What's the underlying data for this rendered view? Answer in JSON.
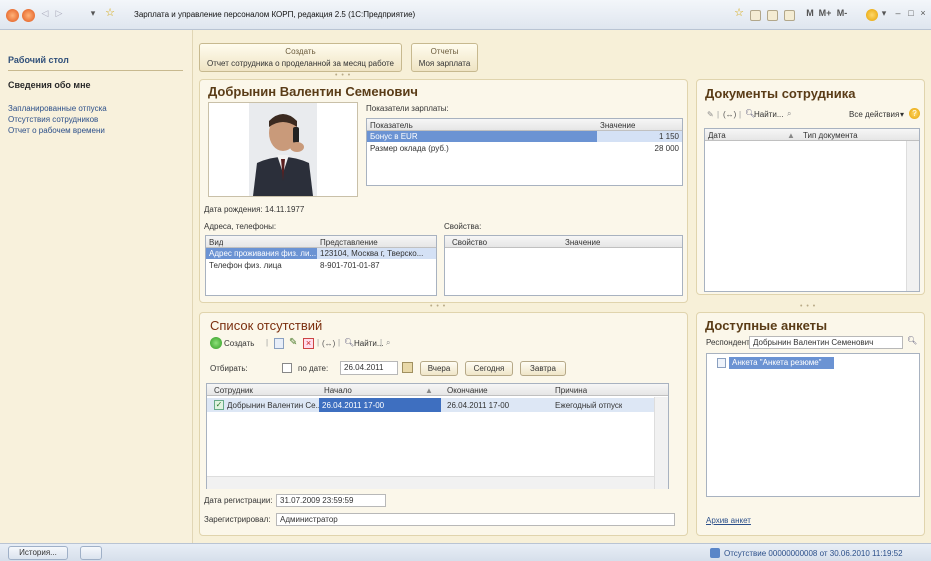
{
  "window": {
    "title": "Зарплата и управление персоналом КОРП, редакция 2.5  (1С:Предприятие)",
    "right_controls": [
      "M",
      "M+",
      "M-",
      "–",
      "□",
      "×"
    ]
  },
  "sidebar": {
    "desktop": "Рабочий стол",
    "section": "Сведения обо мне",
    "items": [
      "Запланированные отпуска",
      "Отсутствия сотрудников",
      "Отчет о рабочем времени"
    ]
  },
  "commands": {
    "create_label": "Создать",
    "create_item": "Отчет сотрудника о проделанной за месяц работе",
    "reports_label": "Отчеты",
    "reports_item": "Моя зарплата"
  },
  "employee": {
    "name": "Добрынин Валентин Семенович",
    "salary_caption": "Показатели зарплаты:",
    "salary_headers": [
      "Показатель",
      "Значение"
    ],
    "salary_rows": [
      {
        "name": "Бонус в EUR",
        "value": "1 150"
      },
      {
        "name": "Размер оклада (руб.)",
        "value": "28 000"
      }
    ],
    "birth": "Дата рождения:  14.11.1977",
    "addresses_caption": "Адреса, телефоны:",
    "addr_headers": [
      "Вид",
      "Представление"
    ],
    "addr_rows": [
      {
        "kind": "Адрес проживания физ. ли...",
        "value": "123104, Москва г, Тверско..."
      },
      {
        "kind": "Телефон физ. лица",
        "value": "8-901-701-01-87"
      }
    ],
    "props_caption": "Свойства:",
    "props_headers": [
      "Свойство",
      "Значение"
    ]
  },
  "absences": {
    "title": "Список отсутствий",
    "toolbar": {
      "create": "Создать",
      "find": "Найти..."
    },
    "filter_label": "Отбирать:",
    "by_date": "по дате:",
    "date": "26.04.2011",
    "btn_yesterday": "Вчера",
    "btn_today": "Сегодня",
    "btn_tomorrow": "Завтра",
    "headers": [
      "Сотрудник",
      "Начало",
      "Окончание",
      "Причина"
    ],
    "rows": [
      {
        "employee": "Добрынин Валентин Се...",
        "start": "26.04.2011 17-00",
        "end": "26.04.2011 17-00",
        "reason": "Ежегодный отпуск"
      }
    ],
    "reg_date_label": "Дата регистрации:",
    "reg_date": "31.07.2009 23:59:59",
    "registered_label": "Зарегистрировал:",
    "registered": "Администратор"
  },
  "documents": {
    "title": "Документы сотрудника",
    "find": "Найти...",
    "all_actions": "Все действия",
    "headers": [
      "Дата",
      "Тип документа"
    ]
  },
  "surveys": {
    "title": "Доступные анкеты",
    "respondent_label": "Респондент:",
    "respondent": "Добрынин Валентин Семенович",
    "items": [
      "Анкета \"Анкета резюме\""
    ],
    "archive_link": "Архив анкет"
  },
  "status": {
    "history": "История...",
    "message": "Отсутствие 00000000008 от 30.06.2010 11:19:52"
  },
  "colors": {
    "accent_title": "#7b2f0f",
    "selection": "#6b93d3",
    "link": "#2b4f8a"
  }
}
